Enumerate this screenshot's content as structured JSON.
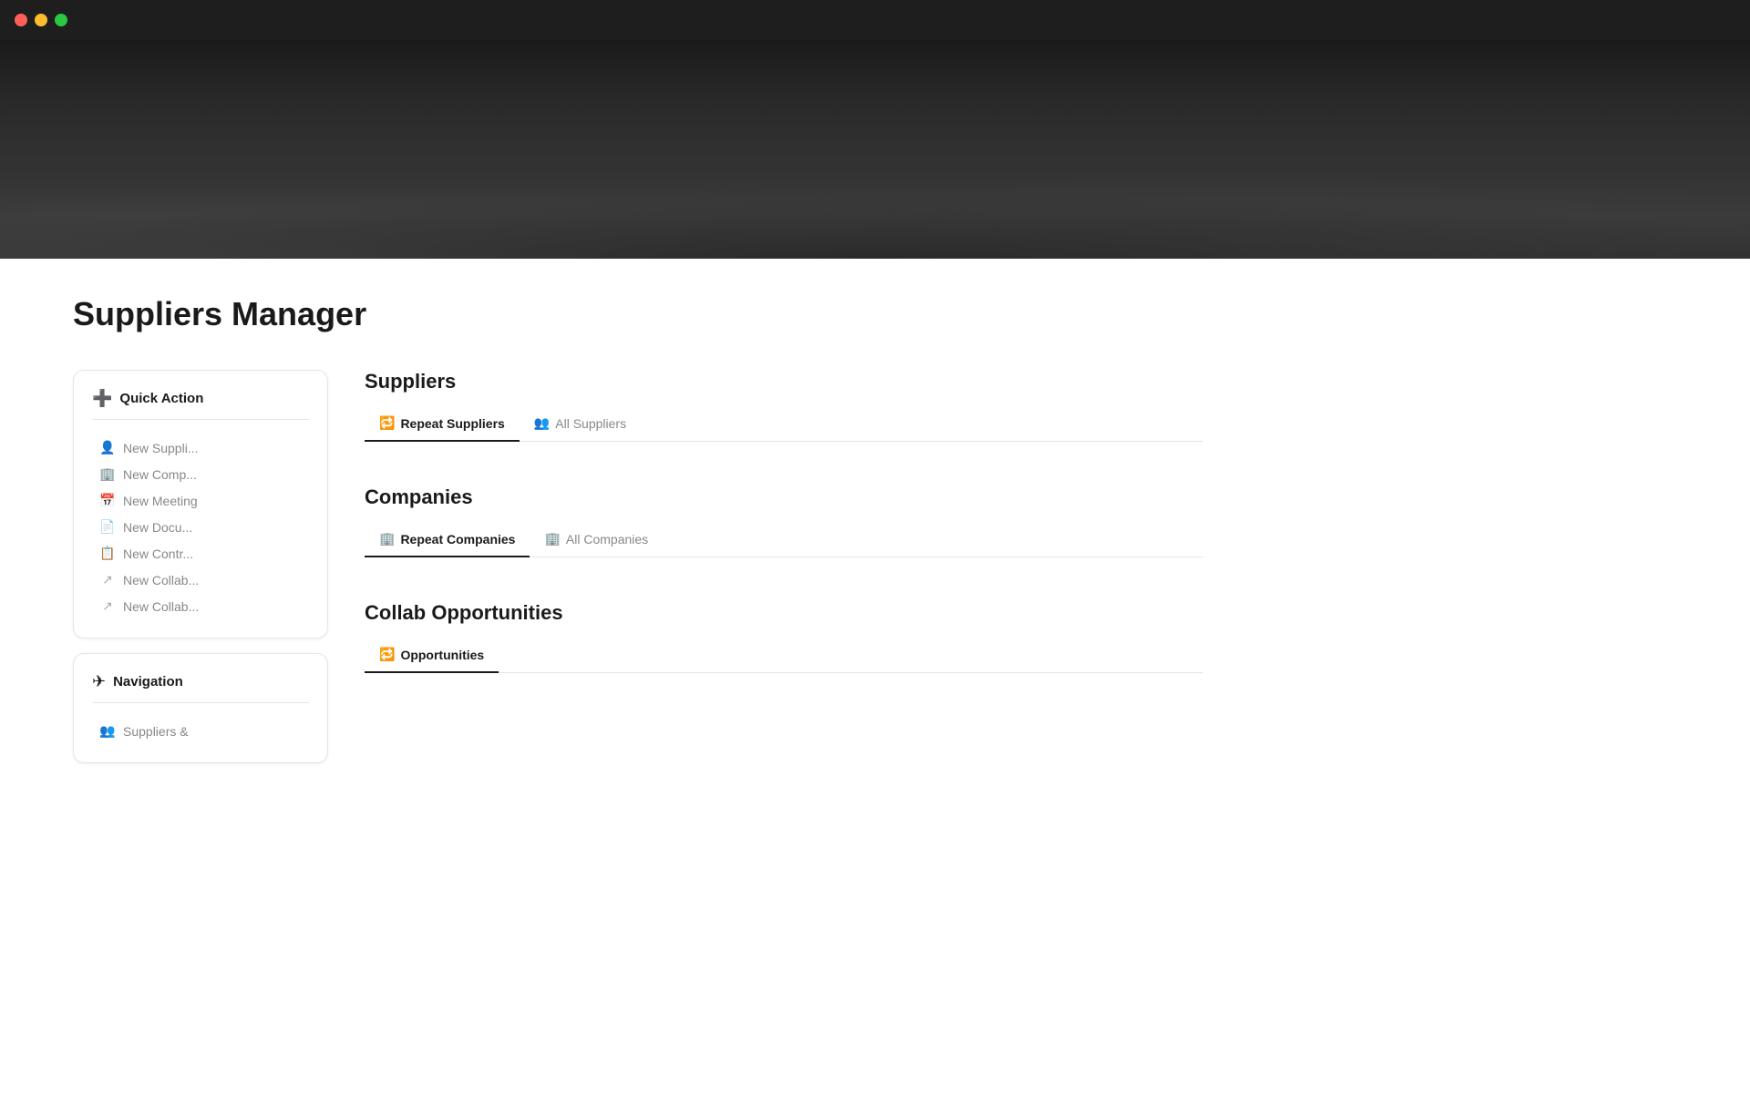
{
  "titlebar": {
    "traffic_lights": [
      "red",
      "yellow",
      "green"
    ]
  },
  "page": {
    "title": "Suppliers Manager"
  },
  "sidebar": {
    "quick_action": {
      "title": "Quick Action",
      "icon": "➕",
      "items": [
        {
          "id": "new-supplier",
          "label": "New Suppli...",
          "icon": "👤"
        },
        {
          "id": "new-company",
          "label": "New Comp...",
          "icon": "🏢"
        },
        {
          "id": "new-meeting",
          "label": "New Meeting",
          "icon": "📅"
        },
        {
          "id": "new-document",
          "label": "New Docu...",
          "icon": "📄"
        },
        {
          "id": "new-contract",
          "label": "New Contr...",
          "icon": "📋"
        },
        {
          "id": "new-collab1",
          "label": "New Collab...",
          "icon": "↗"
        },
        {
          "id": "new-collab2",
          "label": "New Collab...",
          "icon": "↗"
        }
      ]
    },
    "navigation": {
      "title": "Navigation",
      "icon": "✈",
      "items": [
        {
          "id": "suppliers-link",
          "label": "Suppliers &",
          "icon": "👥"
        }
      ]
    }
  },
  "sections": {
    "suppliers": {
      "heading": "Suppliers",
      "tabs": [
        {
          "id": "repeat-suppliers",
          "label": "Repeat Suppliers",
          "icon": "🔁",
          "active": true
        },
        {
          "id": "all-suppliers",
          "label": "All Suppliers",
          "icon": "👥",
          "active": false
        }
      ]
    },
    "companies": {
      "heading": "Companies",
      "tabs": [
        {
          "id": "repeat-companies",
          "label": "Repeat Companies",
          "icon": "🏢",
          "active": true
        },
        {
          "id": "all-companies",
          "label": "All Companies",
          "icon": "🏢",
          "active": false
        }
      ]
    },
    "collab": {
      "heading": "Collab Opportunities",
      "tabs": [
        {
          "id": "opportunities",
          "label": "Opportunities",
          "icon": "🔁",
          "active": true
        }
      ]
    }
  }
}
